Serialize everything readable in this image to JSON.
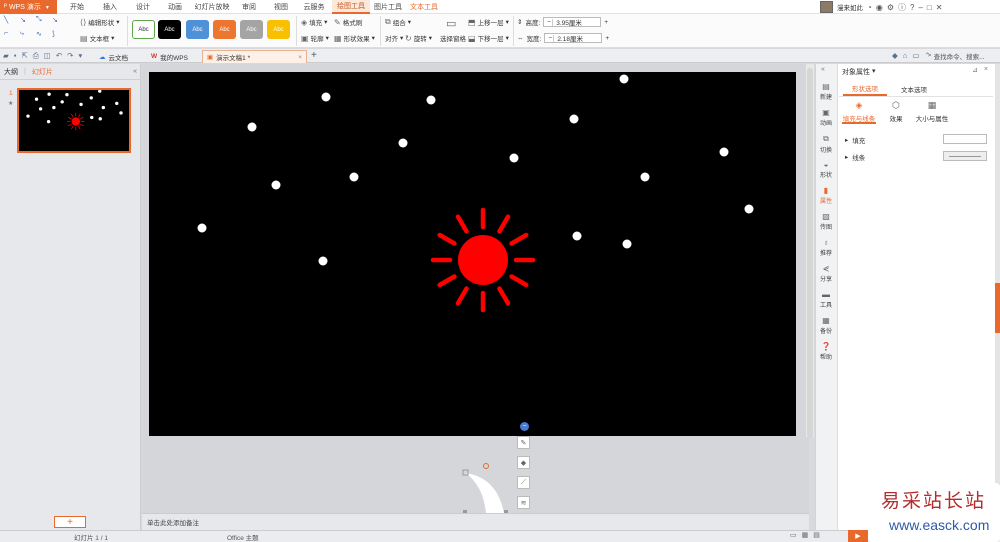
{
  "app": {
    "name": "WPS 演示"
  },
  "menu": {
    "items": [
      "开始",
      "插入",
      "设计",
      "动画",
      "幻灯片放映",
      "审阅",
      "视图",
      "云服务",
      "绘图工具",
      "图片工具",
      "文本工具"
    ],
    "active": "绘图工具"
  },
  "user": {
    "name": "漫来如此"
  },
  "ribbon": {
    "edit_shape": "编辑形状",
    "text_box": "文本框",
    "style_label": "Abc",
    "fill": "填充",
    "format_painter": "格式刷",
    "outline": "轮廓",
    "shape_effect": "形状效果",
    "group": "组合",
    "rotate": "旋转",
    "align": "对齐",
    "selection_pane": "选择窗格",
    "bring_forward": "上移一层",
    "send_backward": "下移一层",
    "height_label": "高度:",
    "height_value": "3.95厘米",
    "width_label": "宽度:",
    "width_value": "2.18厘米"
  },
  "colors": {
    "accent": "#e9692c",
    "sun": "#ff0000",
    "slide_bg": "#000000",
    "stars": "#ffffff"
  },
  "tabs": {
    "cloud_docs": "云文档",
    "my_wps": "我的WPS",
    "current_doc": "演示文稿1 *",
    "new_tab": "+"
  },
  "search": {
    "placeholder": "查找命令、搜索..."
  },
  "left_panel": {
    "tab_outline": "大纲",
    "tab_slides": "幻灯片",
    "slide_number": "1",
    "add_slide": "+"
  },
  "notes": {
    "placeholder": "单击此处添加备注"
  },
  "right_rail": {
    "items": [
      "新建",
      "动画",
      "切换",
      "形状",
      "属性",
      "传图",
      "推荐",
      "分享",
      "工具",
      "备份",
      "帮助"
    ],
    "active": "属性"
  },
  "property_panel": {
    "title": "对象属性",
    "tab_shape": "形状选项",
    "tab_text": "文本选项",
    "subtab_fill": "填充与线条",
    "subtab_effect": "效果",
    "subtab_size": "大小与属性",
    "row_fill": "填充",
    "row_line": "线条"
  },
  "status": {
    "slide_info": "幻灯片 1 / 1",
    "theme": "Office 主题"
  },
  "watermark": {
    "line1": "易采站长站",
    "line2": "www.easck.com"
  }
}
